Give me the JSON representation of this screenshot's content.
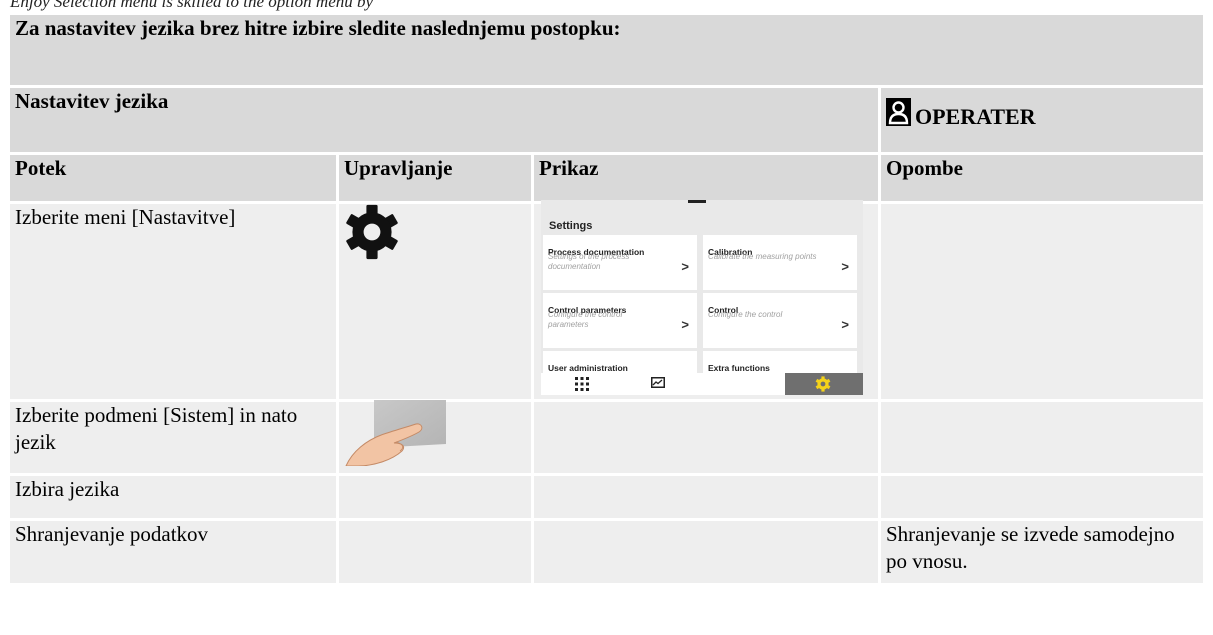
{
  "top_fragment": "Enjoy Selection menu is skilled to the option menu by",
  "title": "Za nastavitev jezika brez hitre izbire sledite naslednjemu postopku:",
  "section": {
    "label": "Nastavitev jezika",
    "role_icon": "user-icon",
    "role_label": "OPERATER"
  },
  "columns": [
    "Potek",
    "Upravljanje",
    "Prikaz",
    "Opombe"
  ],
  "rows": [
    {
      "potek": "Izberite meni [Nastavitve]",
      "control_icon": "gear-icon",
      "opombe": ""
    },
    {
      "potek": "Izberite podmeni [Sistem] in nato jezik",
      "control_icon": "finger-tap-icon",
      "opombe": ""
    },
    {
      "potek": "Izbira jezika",
      "opombe": ""
    },
    {
      "potek": "Shranjevanje podatkov",
      "opombe": "Shranjevanje se izvede samodejno po vnosu."
    }
  ],
  "settings_screen": {
    "title": "Settings",
    "cards": [
      {
        "title": "Process documentation",
        "desc": "Settings of the process documentation",
        "chevron": ">"
      },
      {
        "title": "Calibration",
        "desc": "Calibrate the measuring points",
        "chevron": ">"
      },
      {
        "title": "Control parameters",
        "desc": "Configure the control parameters",
        "chevron": ">"
      },
      {
        "title": "Control",
        "desc": "Configure the control",
        "chevron": ">"
      },
      {
        "title": "User administration"
      },
      {
        "title": "Extra functions"
      }
    ],
    "nav_icons": [
      "grid-icon",
      "chart-icon",
      "gear-icon"
    ],
    "accent": "#f5d31a"
  },
  "colors": {
    "header_bg": "#d9d9d9",
    "row_bg": "#eeeeee"
  }
}
